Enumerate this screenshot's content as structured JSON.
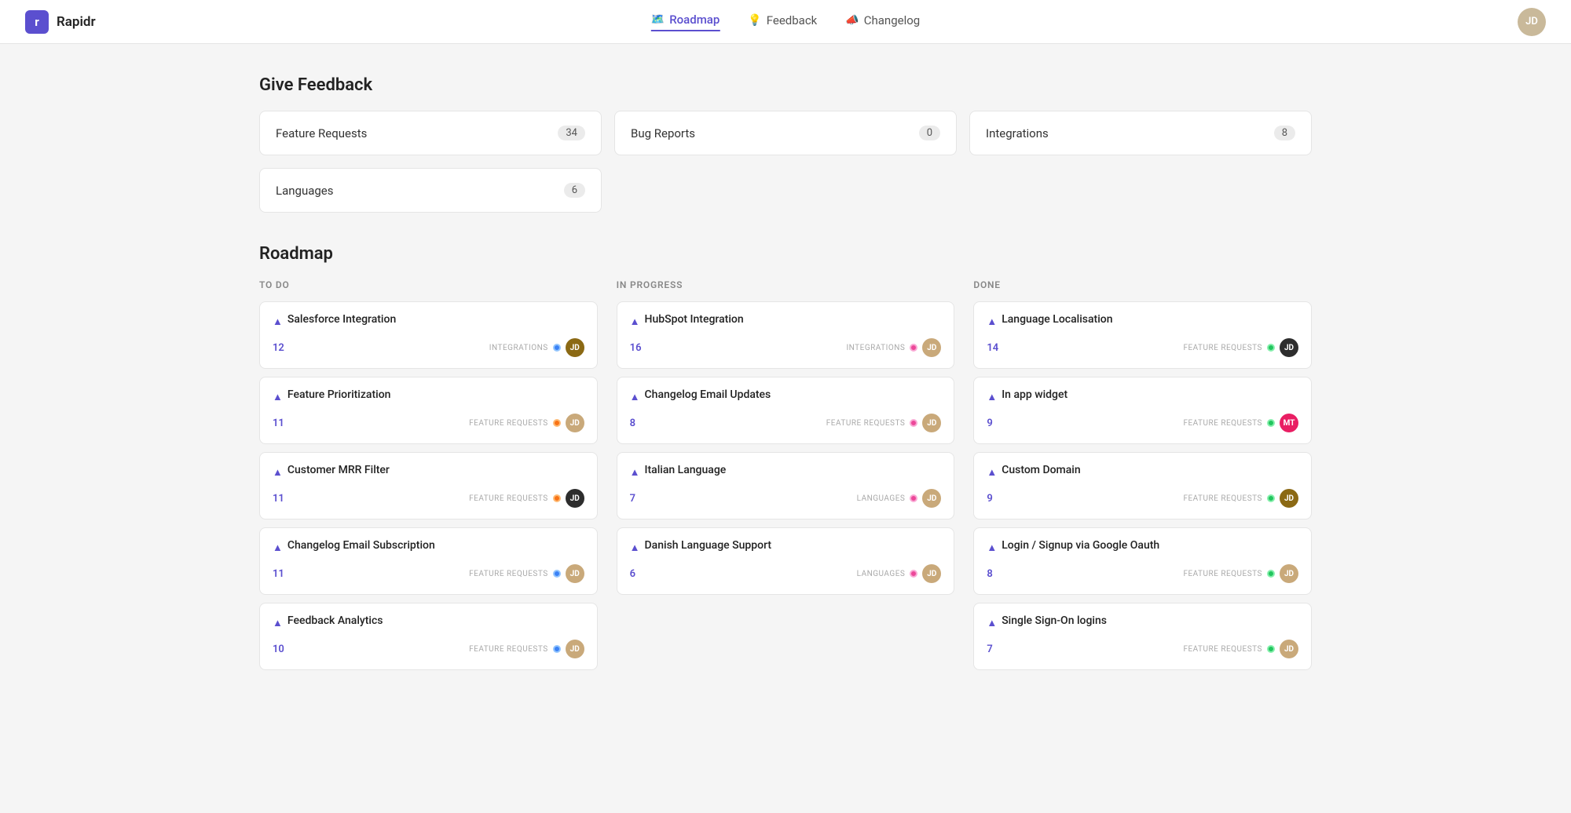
{
  "header": {
    "logo_label": "r",
    "app_name": "Rapidr",
    "nav": [
      {
        "id": "roadmap",
        "label": "Roadmap",
        "icon": "🗺️",
        "active": true
      },
      {
        "id": "feedback",
        "label": "Feedback",
        "icon": "💡",
        "active": false
      },
      {
        "id": "changelog",
        "label": "Changelog",
        "icon": "📣",
        "active": false
      }
    ]
  },
  "give_feedback": {
    "title": "Give Feedback",
    "cards": [
      {
        "label": "Feature Requests",
        "count": "34"
      },
      {
        "label": "Bug Reports",
        "count": "0"
      },
      {
        "label": "Integrations",
        "count": "8"
      },
      {
        "label": "Languages",
        "count": "6"
      }
    ]
  },
  "roadmap": {
    "title": "Roadmap",
    "columns": [
      {
        "id": "todo",
        "label": "TO DO",
        "cards": [
          {
            "title": "Salesforce Integration",
            "votes": "12",
            "tag": "INTEGRATIONS",
            "dot": "blue",
            "avatar": "brown"
          },
          {
            "title": "Feature Prioritization",
            "votes": "11",
            "tag": "FEATURE REQUESTS",
            "dot": "orange",
            "avatar": "light"
          },
          {
            "title": "Customer MRR Filter",
            "votes": "11",
            "tag": "FEATURE REQUESTS",
            "dot": "orange",
            "avatar": "dark"
          },
          {
            "title": "Changelog Email Subscription",
            "votes": "11",
            "tag": "FEATURE REQUESTS",
            "dot": "blue",
            "avatar": "light"
          },
          {
            "title": "Feedback Analytics",
            "votes": "10",
            "tag": "FEATURE REQUESTS",
            "dot": "blue",
            "avatar": "light"
          }
        ]
      },
      {
        "id": "in-progress",
        "label": "IN PROGRESS",
        "cards": [
          {
            "title": "HubSpot Integration",
            "votes": "16",
            "tag": "INTEGRATIONS",
            "dot": "pink",
            "avatar": "light"
          },
          {
            "title": "Changelog Email Updates",
            "votes": "8",
            "tag": "FEATURE REQUESTS",
            "dot": "pink",
            "avatar": "light"
          },
          {
            "title": "Italian Language",
            "votes": "7",
            "tag": "LANGUAGES",
            "dot": "pink",
            "avatar": "light"
          },
          {
            "title": "Danish Language Support",
            "votes": "6",
            "tag": "LANGUAGES",
            "dot": "pink",
            "avatar": "light"
          }
        ]
      },
      {
        "id": "done",
        "label": "DONE",
        "cards": [
          {
            "title": "Language Localisation",
            "votes": "14",
            "tag": "FEATURE REQUESTS",
            "dot": "green",
            "avatar": "dark"
          },
          {
            "title": "In app widget",
            "votes": "9",
            "tag": "FEATURE REQUESTS",
            "dot": "green",
            "avatar": "mt"
          },
          {
            "title": "Custom Domain",
            "votes": "9",
            "tag": "FEATURE REQUESTS",
            "dot": "green",
            "avatar": "brown"
          },
          {
            "title": "Login / Signup via Google Oauth",
            "votes": "8",
            "tag": "FEATURE REQUESTS",
            "dot": "green",
            "avatar": "light"
          },
          {
            "title": "Single Sign-On logins",
            "votes": "7",
            "tag": "FEATURE REQUESTS",
            "dot": "green",
            "avatar": "light"
          }
        ]
      }
    ]
  }
}
